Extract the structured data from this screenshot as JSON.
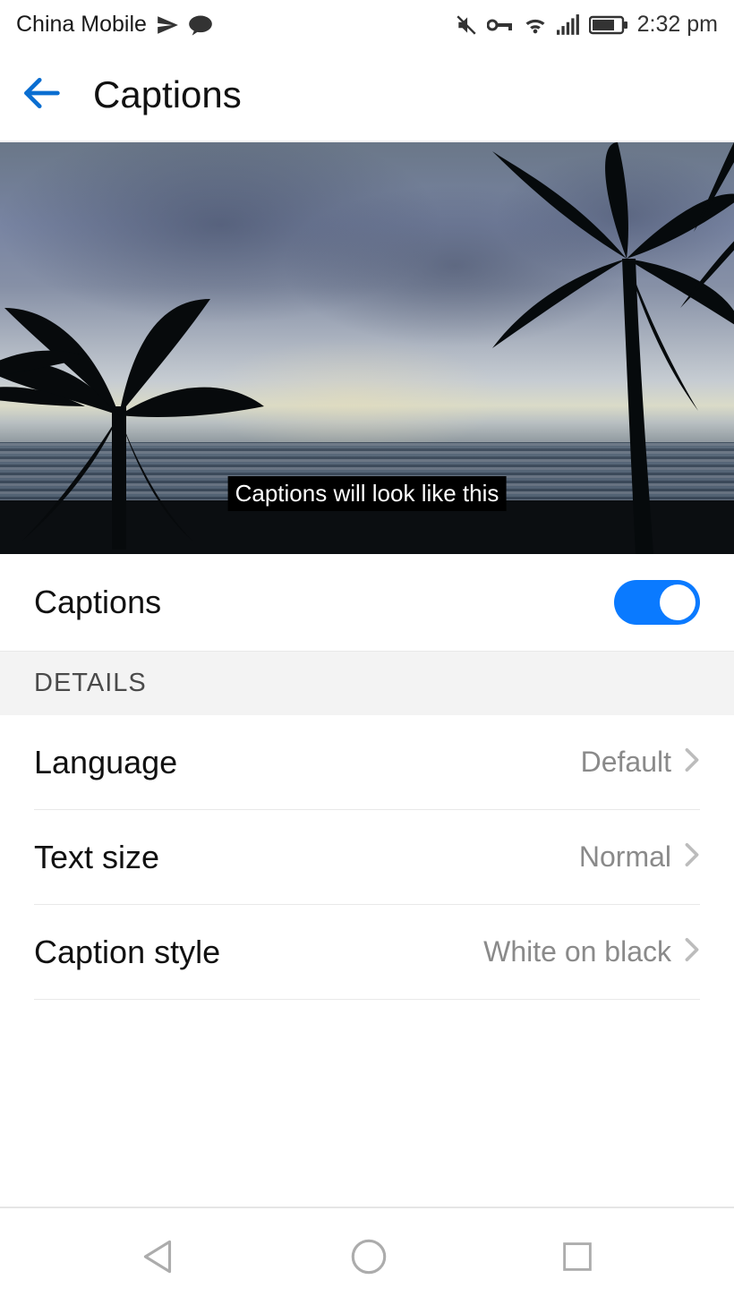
{
  "status": {
    "carrier": "China Mobile",
    "time": "2:32 pm"
  },
  "header": {
    "title": "Captions"
  },
  "preview": {
    "caption_sample": "Captions will look like this"
  },
  "toggle": {
    "label": "Captions",
    "on": true
  },
  "section": {
    "details_label": "DETAILS"
  },
  "settings": {
    "language": {
      "label": "Language",
      "value": "Default"
    },
    "text_size": {
      "label": "Text size",
      "value": "Normal"
    },
    "caption_style": {
      "label": "Caption style",
      "value": "White on black"
    }
  }
}
